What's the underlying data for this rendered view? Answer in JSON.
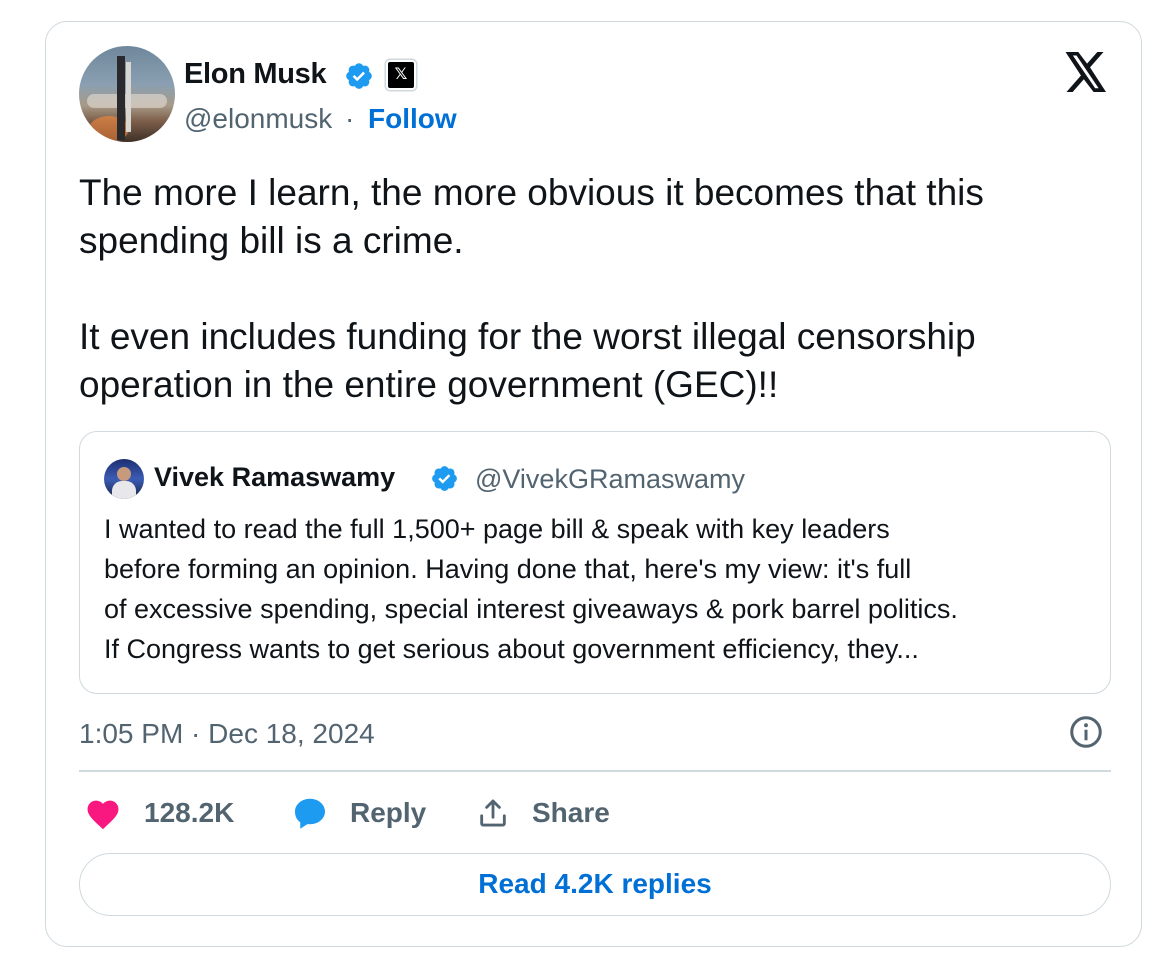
{
  "author": {
    "name": "Elon Musk",
    "handle": "@elonmusk",
    "separator": "·",
    "follow_label": "Follow",
    "avatar_icon": "rocket-launch-photo",
    "verified_icon": "verified-badge-icon",
    "affiliate_icon": "x-affiliate-badge-icon",
    "affiliate_badge_text": "𝕏"
  },
  "tweet": {
    "paragraphs": [
      "The more I learn, the more obvious it becomes that this spending bill is a crime.",
      "It even includes funding for the worst illegal censorship operation in the entire government (GEC)!!"
    ]
  },
  "quote": {
    "name": "Vivek Ramaswamy",
    "handle": "@VivekGRamaswamy",
    "lines": [
      "I wanted to read the full 1,500+ page bill & speak with key leaders",
      "before forming an opinion. Having done that, here's my view: it's full",
      "of excessive spending, special interest giveaways & pork barrel politics.",
      "If Congress wants to get serious about government efficiency, they..."
    ]
  },
  "meta": {
    "timestamp": "1:05 PM · Dec 18, 2024"
  },
  "actions": {
    "likes": "128.2K",
    "reply_label": "Reply",
    "share_label": "Share"
  },
  "read_replies_label": "Read 4.2K replies",
  "colors": {
    "accent": "#006fd6",
    "verified": "#1d9bf0",
    "like": "#f91880",
    "secondary_text": "#536471",
    "border": "#cfd9de"
  }
}
